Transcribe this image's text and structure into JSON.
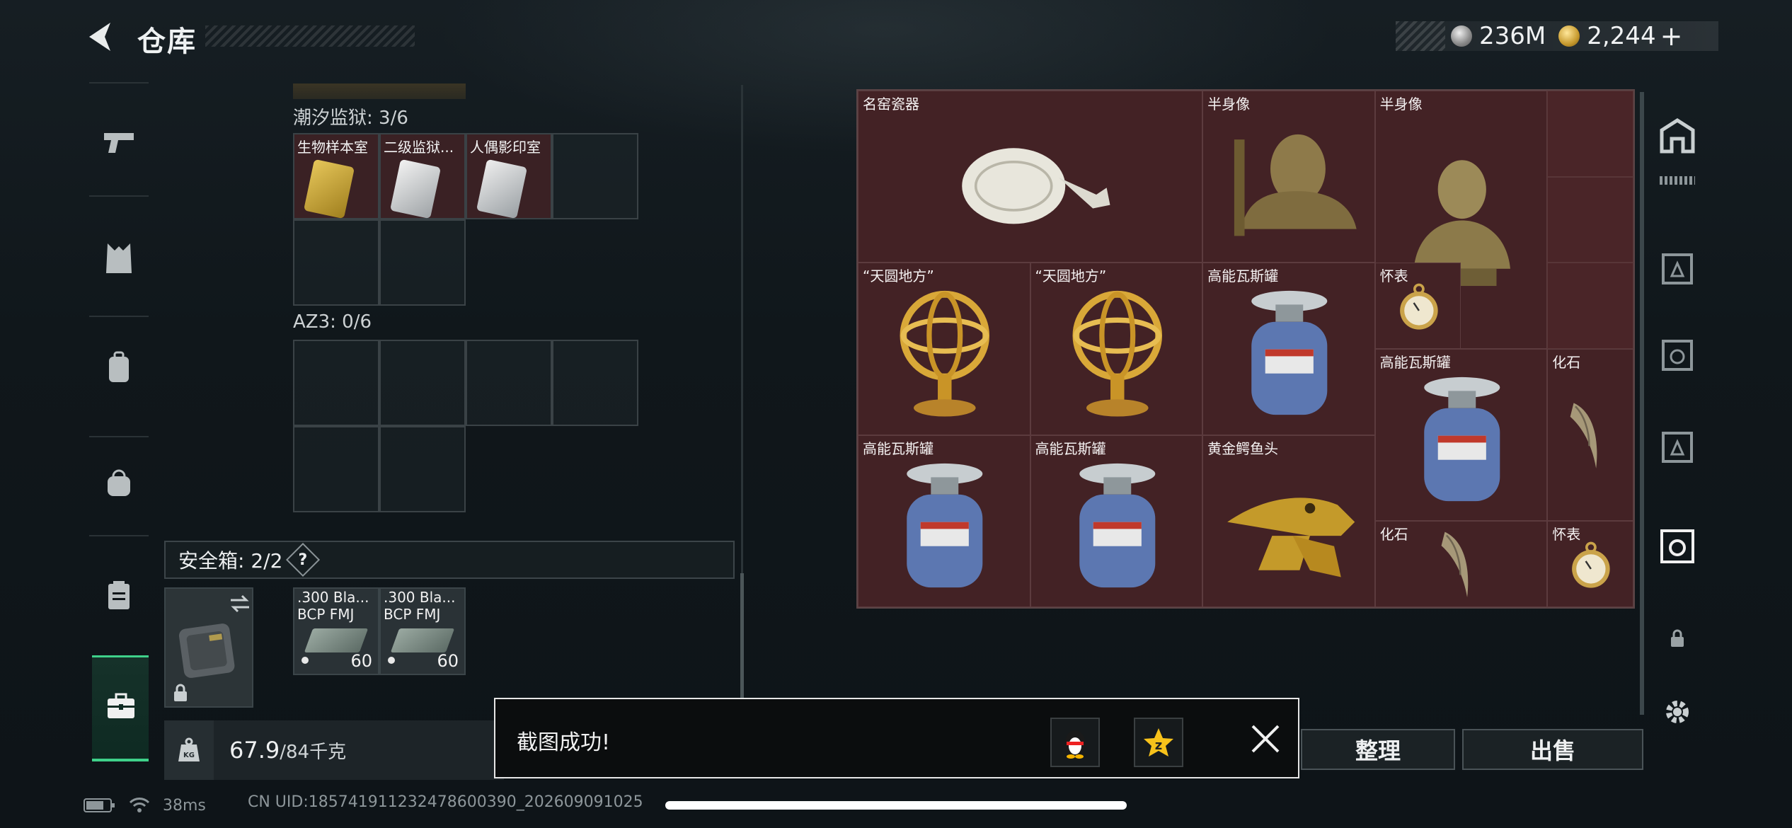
{
  "header": {
    "title": "仓库",
    "currency": [
      {
        "icon": "silver-coin-icon",
        "value": "236M"
      },
      {
        "icon": "gold-coin-icon",
        "value": "2,244"
      }
    ],
    "add_label": "+"
  },
  "sidebar": {
    "items": [
      {
        "icon": "pistol-icon"
      },
      {
        "icon": "vest-icon"
      },
      {
        "icon": "backpack-icon"
      },
      {
        "icon": "bag-icon"
      },
      {
        "icon": "clipboard-icon"
      },
      {
        "icon": "briefcase-icon",
        "active": true
      }
    ]
  },
  "left_panel": {
    "section1": {
      "title": "潮汐监狱: 3/6",
      "cards": [
        {
          "label": "生物样本室",
          "color": "#c8a53a"
        },
        {
          "label": "二级监狱...",
          "color": "#d4d4d4"
        },
        {
          "label": "人偶影印室",
          "color": "#cfcfcf"
        }
      ]
    },
    "section2": {
      "title": "AZ3: 0/6"
    },
    "safe_box": {
      "label": "安全箱: 2/2",
      "help": "?",
      "ammo": [
        {
          "name": ".300 Bla...\nBCP FMJ",
          "count": "60"
        },
        {
          "name": ".300 Bla...\nBCP FMJ",
          "count": "60"
        }
      ]
    },
    "weight": {
      "current": "67.9",
      "max": "/84千克",
      "icon_text": "KG"
    }
  },
  "stash": {
    "items": [
      {
        "label": "名窑瓷器",
        "kind": "vase"
      },
      {
        "label": "半身像",
        "kind": "bust-bronze"
      },
      {
        "label": "半身像",
        "kind": "bust-gold"
      },
      {
        "label": "“天圆地方”",
        "kind": "armillary"
      },
      {
        "label": "“天圆地方”",
        "kind": "armillary"
      },
      {
        "label": "高能瓦斯罐",
        "kind": "gas"
      },
      {
        "label": "怀表",
        "kind": "watch"
      },
      {
        "label": "高能瓦斯罐",
        "kind": "gas"
      },
      {
        "label": "化石",
        "kind": "fossil"
      },
      {
        "label": "高能瓦斯罐",
        "kind": "gas"
      },
      {
        "label": "高能瓦斯罐",
        "kind": "gas"
      },
      {
        "label": "黄金鳄鱼头",
        "kind": "croc"
      },
      {
        "label": "化石",
        "kind": "fossil"
      },
      {
        "label": "怀表",
        "kind": "watch"
      }
    ]
  },
  "actions": {
    "sort_label": "整理",
    "sell_label": "出售"
  },
  "toast": {
    "message": "截图成功!"
  },
  "status_bar": {
    "ping": "38ms",
    "uid": "CN UID:18574191123247860039​0_202609091025"
  }
}
